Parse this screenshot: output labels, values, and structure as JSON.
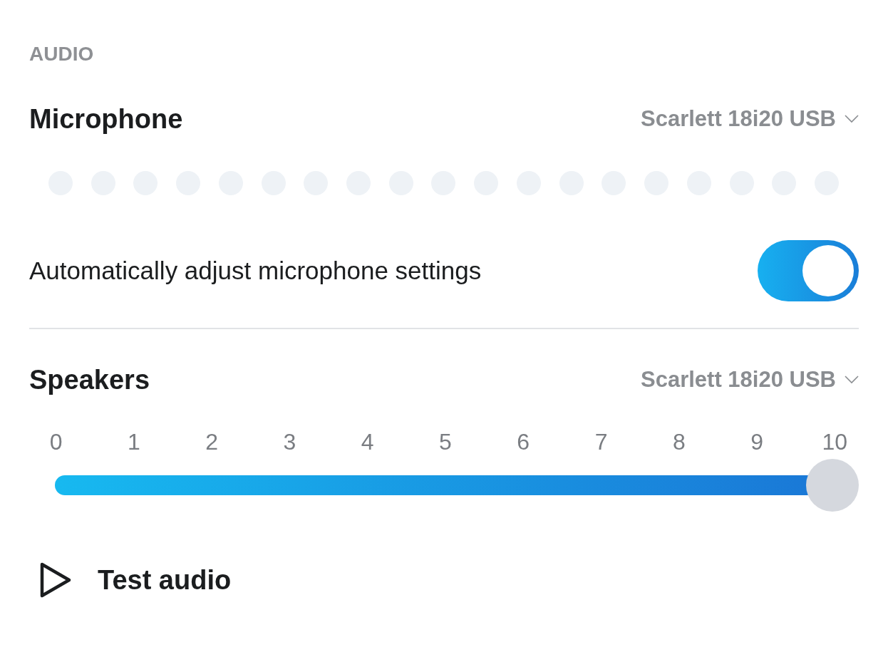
{
  "section_title": "AUDIO",
  "microphone": {
    "label": "Microphone",
    "device": "Scarlett 18i20 USB",
    "meter_dots": [
      {
        "lit": false
      },
      {
        "lit": false
      },
      {
        "lit": false
      },
      {
        "lit": false
      },
      {
        "lit": false
      },
      {
        "lit": false
      },
      {
        "lit": false
      },
      {
        "lit": false
      },
      {
        "lit": false
      },
      {
        "lit": false
      },
      {
        "lit": false
      },
      {
        "lit": false
      },
      {
        "lit": false
      },
      {
        "lit": false
      },
      {
        "lit": false
      },
      {
        "lit": false
      },
      {
        "lit": false
      },
      {
        "lit": false
      },
      {
        "lit": false
      }
    ]
  },
  "auto_adjust": {
    "label": "Automatically adjust microphone settings",
    "on": true
  },
  "speakers": {
    "label": "Speakers",
    "device": "Scarlett 18i20 USB",
    "ticks": [
      "0",
      "1",
      "2",
      "3",
      "4",
      "5",
      "6",
      "7",
      "8",
      "9",
      "10"
    ],
    "volume": {
      "level": 1
    }
  },
  "test_button": {
    "label": "Test audio"
  }
}
